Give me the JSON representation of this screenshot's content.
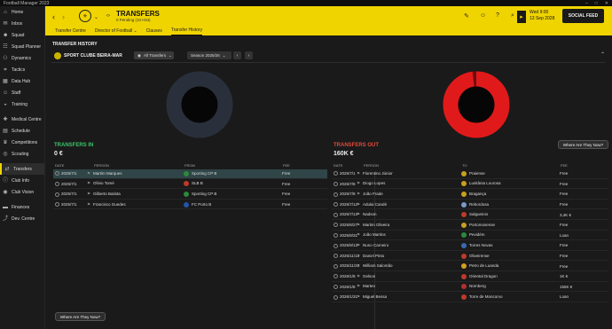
{
  "window": {
    "title": "Football Manager 2023",
    "controls": [
      "–",
      "□",
      "✕"
    ]
  },
  "sidebar": {
    "items": [
      {
        "label": "Home",
        "icon": "home-icon",
        "glyph": "⌂"
      },
      {
        "label": "Inbox",
        "icon": "inbox-icon",
        "glyph": "✉"
      },
      {
        "label": "Squad",
        "icon": "squad-icon",
        "glyph": "☻"
      },
      {
        "label": "Squad Planner",
        "icon": "planner-icon",
        "glyph": "☷"
      },
      {
        "label": "Dynamics",
        "icon": "dynamics-icon",
        "glyph": "⚇"
      },
      {
        "label": "Tactics",
        "icon": "tactics-icon",
        "glyph": "⌗"
      },
      {
        "label": "Data Hub",
        "icon": "data-hub-icon",
        "glyph": "▦"
      },
      {
        "label": "Staff",
        "icon": "staff-icon",
        "glyph": "☺"
      },
      {
        "label": "Training",
        "icon": "training-icon",
        "glyph": "◒"
      },
      {
        "label": "Medical Centre",
        "icon": "medical-icon",
        "glyph": "✚"
      },
      {
        "label": "Schedule",
        "icon": "schedule-icon",
        "glyph": "▤"
      },
      {
        "label": "Competitions",
        "icon": "competitions-icon",
        "glyph": "♛"
      },
      {
        "label": "Scouting",
        "icon": "scouting-icon",
        "glyph": "◎"
      },
      {
        "label": "Transfers",
        "icon": "transfers-icon",
        "glyph": "⇄"
      },
      {
        "label": "Club Info",
        "icon": "club-info-icon",
        "glyph": "ⓘ"
      },
      {
        "label": "Club Vision",
        "icon": "club-vision-icon",
        "glyph": "◉"
      },
      {
        "label": "Finances",
        "icon": "finances-icon",
        "glyph": "▬"
      },
      {
        "label": "Dev. Centre",
        "icon": "dev-centre-icon",
        "glyph": "⤴"
      }
    ]
  },
  "header": {
    "title": "TRANSFERS",
    "subtitle": "0 Pending (10 Hist)",
    "date_day": "Wed 9:00",
    "date_full": "13 Sep 2028",
    "social_feed": "SOCIAL FEED",
    "accent": "#f0d400"
  },
  "tabs": [
    {
      "label": "Transfer Centre"
    },
    {
      "label": "Director of Football ⌄"
    },
    {
      "label": "Clauses"
    },
    {
      "label": "Transfer History"
    }
  ],
  "history": {
    "section_title": "TRANSFER HISTORY",
    "club": "SPORT CLUBE BEIRA-MAR",
    "filter": "All Transfers",
    "season": "Season 2025/26",
    "transfers_in": {
      "title": "TRANSFERS IN",
      "amount": "0 €",
      "color": "#3cc46a",
      "donut_fill_pct": 0,
      "columns": [
        "DATE",
        "PERSON",
        "FROM",
        "FEE"
      ],
      "rows": [
        {
          "date": "2025/7/1",
          "person": "Martim Marques",
          "club": "Sporting CP B",
          "fee": "Free",
          "club_color": "#2a8a3c"
        },
        {
          "date": "2025/7/1",
          "person": "Olívio Tomé",
          "club": "SLB B",
          "fee": "Free",
          "club_color": "#c0392b"
        },
        {
          "date": "2025/7/1",
          "person": "Gilberto Batista",
          "club": "Sporting CP B",
          "fee": "Free",
          "club_color": "#2a8a3c"
        },
        {
          "date": "2025/7/1",
          "person": "Francisco Guedes",
          "club": "FC Porto B",
          "fee": "Free",
          "club_color": "#2255aa"
        }
      ],
      "where_button": "Where Are They Now?"
    },
    "transfers_out": {
      "title": "TRANSFERS OUT",
      "amount": "160K €",
      "color": "#e04a3a",
      "donut_fill_pct": 98,
      "columns": [
        "DATE",
        "PERSON",
        "TO",
        "FEE"
      ],
      "rows": [
        {
          "date": "2025/7/1",
          "person": "Florentino Júnior",
          "club": "Praiense",
          "fee": "Free",
          "club_color": "#c8a020"
        },
        {
          "date": "2025/7/8",
          "person": "Diogo Lopes",
          "club": "Lusitânia Lourosa",
          "fee": "Free",
          "club_color": "#c8a020"
        },
        {
          "date": "2025/7/8",
          "person": "João Frade",
          "club": "Bragança",
          "fee": "Free",
          "club_color": "#c8a020"
        },
        {
          "date": "2025/7/12",
          "person": "Adulai Candé",
          "club": "Rebordosa",
          "fee": "Free",
          "club_color": "#7a9ac8"
        },
        {
          "date": "2025/7/13",
          "person": "Nadson",
          "club": "Salgueiros",
          "fee": "3,4K €",
          "club_color": "#c0392b"
        },
        {
          "date": "2025/8/27",
          "person": "Martim Oliveira",
          "club": "Portomosense",
          "fee": "Free",
          "club_color": "#c8a020"
        },
        {
          "date": "2025/8/31",
          "person": "João Martins",
          "club": "Pevidém",
          "fee": "Loan",
          "club_color": "#2a8a3c"
        },
        {
          "date": "2025/9/13",
          "person": "Nuno Carneiro",
          "club": "Torres Novas",
          "fee": "Free",
          "club_color": "#3a6ab0"
        },
        {
          "date": "2025/11/13",
          "person": "Daniel Pinto",
          "club": "Oliveirense",
          "fee": "Free",
          "club_color": "#c0392b"
        },
        {
          "date": "2025/11/23",
          "person": "William Salomão",
          "club": "Petro de Luanda",
          "fee": "Free",
          "club_color": "#d4a020"
        },
        {
          "date": "2026/1/8",
          "person": "Gelson",
          "club": "Oriental Dragon",
          "fee": "1K €",
          "club_color": "#c0392b"
        },
        {
          "date": "2026/1/8",
          "person": "Marteo",
          "club": "Nürnberg",
          "fee": "155K €",
          "club_color": "#b03030"
        },
        {
          "date": "2026/1/31",
          "person": "Miguel Bessa",
          "club": "Torre de Moncorvo",
          "fee": "Loan",
          "club_color": "#c0392b"
        }
      ],
      "where_button": "Where Are They Now?"
    }
  }
}
